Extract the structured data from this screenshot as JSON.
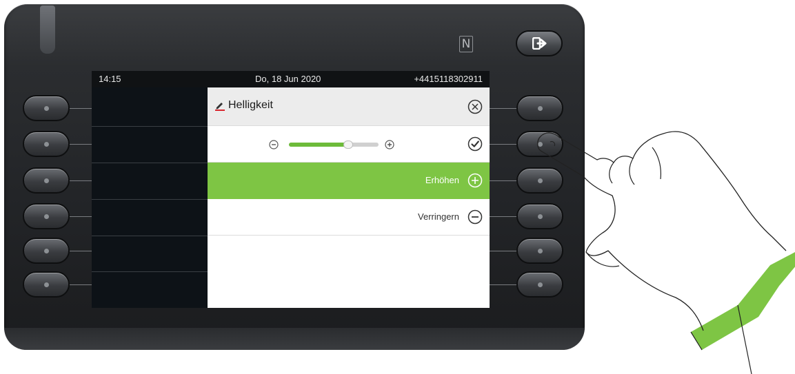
{
  "status_bar": {
    "time": "14:15",
    "date": "Do, 18 Jun 2020",
    "phone_number": "+4415118302911"
  },
  "dialog": {
    "title": "Helligkeit",
    "slider": {
      "value_fraction": 0.66
    },
    "options": [
      {
        "label": "Erhöhen",
        "icon": "plus-circle-icon",
        "highlighted": true
      },
      {
        "label": "Verringern",
        "icon": "minus-circle-icon",
        "highlighted": false
      }
    ]
  },
  "icons": {
    "nfc": "N"
  },
  "colors": {
    "accent_green": "#7ec544",
    "slider_fill": "#6dbb3a",
    "screen_bg": "#0d1217"
  }
}
